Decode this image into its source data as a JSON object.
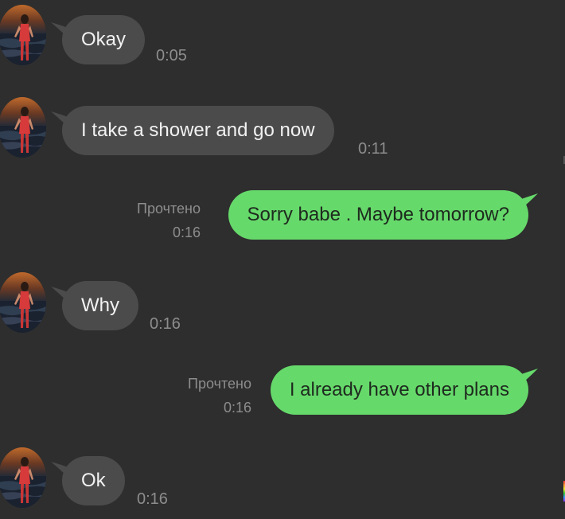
{
  "chat": {
    "messages": [
      {
        "direction": "incoming",
        "text": "Okay",
        "time": "0:05"
      },
      {
        "direction": "incoming",
        "text": "I take a shower and go now",
        "time": "0:11"
      },
      {
        "direction": "outgoing",
        "text": "Sorry babe . Maybe tomorrow?",
        "status": "Прочтено",
        "time": "0:16"
      },
      {
        "direction": "incoming",
        "text": "Why",
        "time": "0:16"
      },
      {
        "direction": "outgoing",
        "text": "I already have other plans",
        "status": "Прочтено",
        "time": "0:16"
      },
      {
        "direction": "incoming",
        "text": "Ok",
        "time": "0:16"
      }
    ]
  },
  "colors": {
    "background": "#2e2e2e",
    "incoming_bubble": "#4b4b4b",
    "outgoing_bubble": "#66d96b",
    "meta_text": "#8d8d8d"
  },
  "icons": {
    "avatar": "contact-avatar-photo"
  }
}
